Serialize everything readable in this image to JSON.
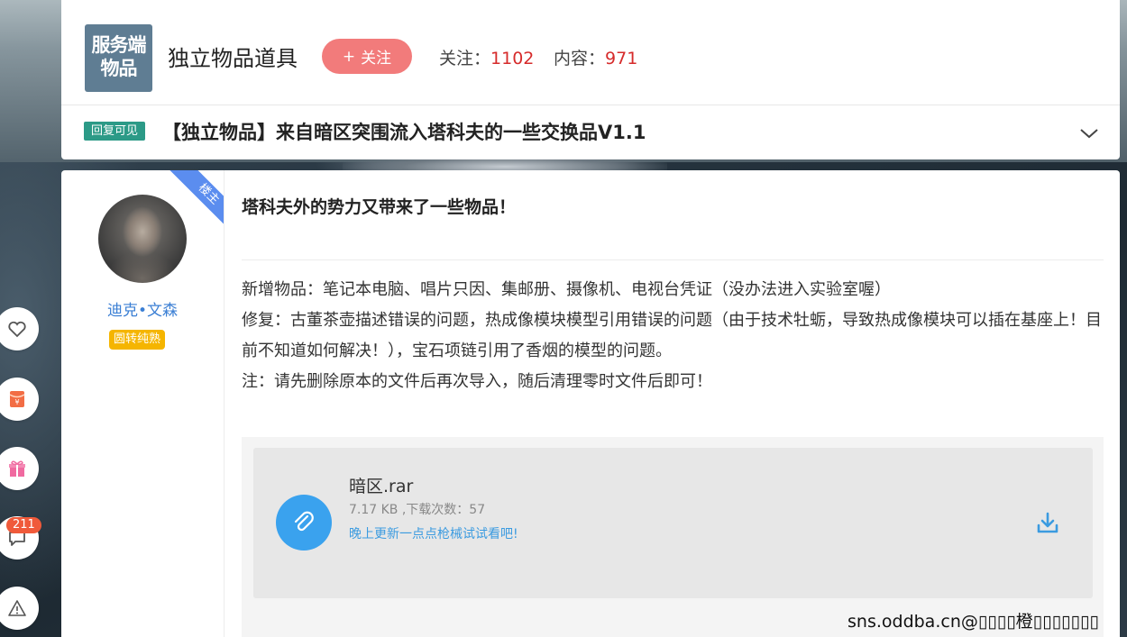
{
  "forum": {
    "logo_text_line1": "服务端",
    "logo_text_line2": "物品",
    "title": "独立物品道具",
    "follow_button_label": "关注",
    "follow_label": "关注：",
    "follow_count": "1102",
    "content_label": "内容：",
    "content_count": "971"
  },
  "thread": {
    "badge": "回复可见",
    "title": "【独立物品】来自暗区突围流入塔科夫的一些交换品V1.1"
  },
  "author": {
    "floor_label": "楼主",
    "name": "迪克•文森",
    "tag": "圆转纯熟"
  },
  "post": {
    "headline": "塔科夫外的势力又带来了一些物品！",
    "lines": [
      "新增物品：笔记本电脑、唱片只因、集邮册、摄像机、电视台凭证（没办法进入实验室喔）",
      "修复：古董茶壶描述错误的问题，热成像模块模型引用错误的问题（由于技术牡蛎，导致热成像模块可以插在基座上！目前不知道如何解决！），宝石项链引用了香烟的模型的问题。",
      "注：请先删除原本的文件后再次导入，随后清理零时文件后即可！"
    ]
  },
  "attachment": {
    "file_name": "暗区.rar",
    "meta": "7.17 KB ,下载次数：57",
    "note": "晚上更新一点点枪械试试看吧!"
  },
  "sidebar": {
    "comment_count": "211"
  },
  "watermark": "sns.oddba.cn@▯▯▯▯橙▯▯▯▯▯▯▯"
}
